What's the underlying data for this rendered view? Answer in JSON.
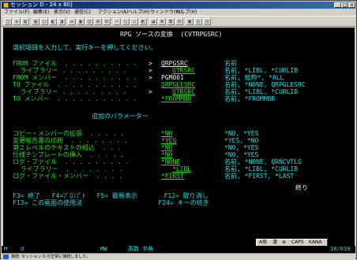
{
  "window": {
    "title": "セッション D - 24 x 80]",
    "controls": {
      "minimize": "_",
      "maximize": "□",
      "close": "×"
    }
  },
  "menu": [
    "ファイル(F)",
    "編集(E)",
    "表示(V)",
    "通信(C)",
    "アクション(A)",
    "ヘルプ(H)",
    "ウィンドウ(W)",
    "ヘルプ(H)"
  ],
  "toolbar": [
    "□",
    "≡",
    "▤",
    "▥",
    "▢",
    "◧",
    "◨",
    "✉",
    "▣",
    "◫",
    "⊞",
    "⊟",
    "✂",
    "▢",
    "☐",
    "◩",
    "◪",
    "⊠",
    "⧉",
    "⊡",
    "▦",
    "◰",
    "◳"
  ],
  "screen": {
    "title": "RPG ソースの変換  (CVTRPGSRC)",
    "instruction": "選択項目を入力して，実行キーを押してください。",
    "params": [
      {
        "label": "FROM ファイル  . . . . . . . . . .",
        "marker": ">",
        "value": "QRPGSRC",
        "options": "名前"
      },
      {
        "label": "  ライブラリー . . . . . . . . .",
        "marker": ">",
        "value": "QTRSRC",
        "options": "名前, *LIBL, *CURLIB"
      },
      {
        "label": "FROM メンバー  . . . . . . . . . .",
        "marker": ">",
        "value": "PGM001",
        "options": "名前, 総称*, *ALL"
      },
      {
        "label": "TO ファイル  . . . . . . . . . . .",
        "marker": "",
        "value": "QRPGLESRC",
        "options": "名前, *NONE, QRPGLESRC"
      },
      {
        "label": "  ライブラリー . . . . . . . . .",
        "marker": ">",
        "value": "QTRSRC",
        "options": "名前, *LIBL, *CURLIB"
      },
      {
        "label": "TO メンバー  . . . . . . . . . . .",
        "marker": "",
        "value": "*FROMMBR",
        "options": "名前, *FROMMBR"
      }
    ],
    "additional_header": "追加のパラメーター",
    "extra_params": [
      {
        "label": "コピー・メンバーの拡張  . . . . .",
        "value": "*NO",
        "options": "*NO, *YES"
      },
      {
        "label": "変更報告書の印刷  . . . . . . . .",
        "value": "*YES",
        "options": "*YES, *NO"
      },
      {
        "label": "第２レベルのテキストの組込  . . .",
        "value": "*NO",
        "options": "*NO, *YES"
      },
      {
        "label": "仕様テンプレートの挿入  . . . . .",
        "value": "*NO",
        "options": "*NO, *YES"
      },
      {
        "label": "ログ・ファイル  . . . . . . . . .",
        "value": "*NONE",
        "options": "名前, *NONE, QRNCVTLG"
      },
      {
        "label": "  ライブラリー  . . . . . . . .",
        "value": "*LIBL",
        "options": "名前, *LIBL, *CURLIB"
      },
      {
        "label": "ログ・ファイル・メンバー  . . . .",
        "value": "*FIRST",
        "options": "名前, *FIRST, *LAST"
      }
    ],
    "bottom_marker": "終り",
    "fkeys_1": "F3= 終了   F4=ﾌﾟﾛﾝﾌﾟﾄ   F5= 最新表示       F12= 取り消し",
    "fkeys_2": "F13= この画面の使用法                    F24= キーの続き"
  },
  "status": {
    "left": "M",
    "mode": "d",
    "mw": "MW",
    "ime_state": "英数 半角",
    "cursor_pos": "18/039"
  },
  "ime_panel": [
    "A般",
    "漢",
    "⊕",
    "CAPS",
    "KANA"
  ],
  "bottom_status": "接続: セッション D が正常に接続しました。"
}
